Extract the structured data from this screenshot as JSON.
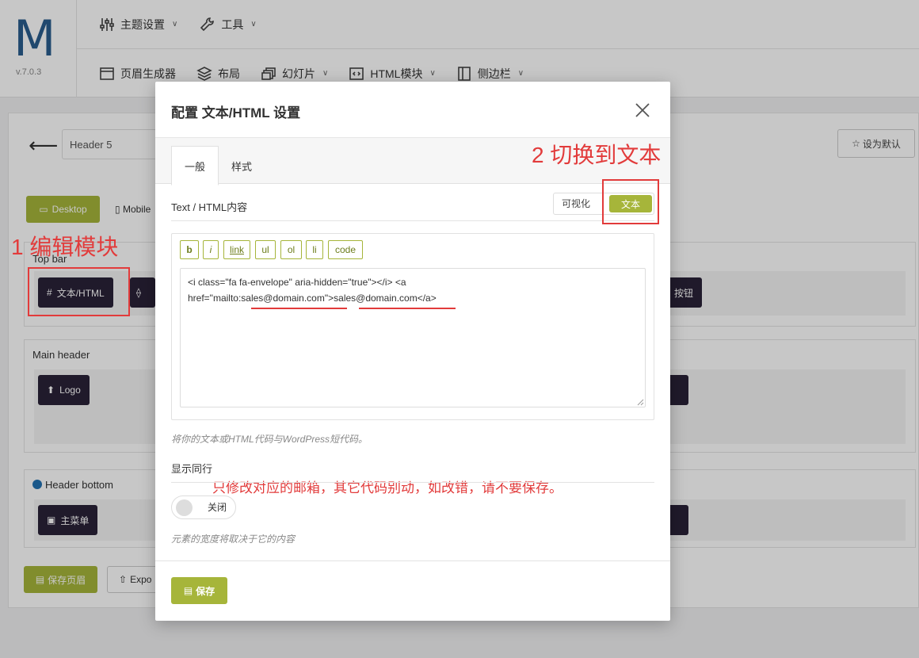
{
  "app": {
    "logo_letter": "M",
    "version": "v.7.0.3",
    "menu_row1": [
      {
        "label": "主题设置",
        "icon": "sliders-icon",
        "dropdown": true
      },
      {
        "label": "工具",
        "icon": "wrench-icon",
        "dropdown": true
      }
    ],
    "menu_row2": [
      {
        "label": "页眉生成器",
        "icon": "window-icon",
        "dropdown": false
      },
      {
        "label": "布局",
        "icon": "layers-icon",
        "dropdown": false
      },
      {
        "label": "幻灯片",
        "icon": "slides-icon",
        "dropdown": true
      },
      {
        "label": "HTML模块",
        "icon": "code-icon",
        "dropdown": true
      },
      {
        "label": "侧边栏",
        "icon": "sidebar-icon",
        "dropdown": true
      }
    ],
    "chevron": "∨"
  },
  "builder": {
    "header_name": "Header 5",
    "set_default": "设为默认",
    "device_desktop": "Desktop",
    "device_mobile": "Mobile",
    "sections": {
      "top_bar": "Top bar",
      "main_header": "Main header",
      "header_bottom": "Header bottom"
    },
    "chips": {
      "text_html": "文本/HTML",
      "button_partial": "按钮",
      "logo": "Logo",
      "main_menu": "主菜单"
    },
    "save_header": "保存页眉",
    "export_partial": "Expo"
  },
  "modal": {
    "title": "配置 文本/HTML 设置",
    "tabs": [
      {
        "label": "一般",
        "active": true
      },
      {
        "label": "样式",
        "active": false
      }
    ],
    "field_label": "Text / HTML内容",
    "mode_visual": "可视化",
    "mode_text": "文本",
    "quicktags": [
      "b",
      "i",
      "link",
      "ul",
      "ol",
      "li",
      "code"
    ],
    "code_line1": "<i class=\"fa fa-envelope\" aria-hidden=\"true\"></i> <a",
    "code_line2_prefix": "href=\"mailto:",
    "code_email": "sales@domain.com",
    "code_line2_mid": "\">",
    "code_line2_suffix": "</a>",
    "help_text": "将你的文本或HTML代码与WordPress短代码。",
    "inline_label": "显示同行",
    "toggle_state": "关闭",
    "toggle_on": false,
    "inline_help": "元素的宽度将取决于它的内容",
    "save": "保存"
  },
  "annotations": {
    "step1": "1 编辑模块",
    "step2": "2 切换到文本",
    "note": "只修改对应的邮箱，其它代码别动，如改错，请不要保存。",
    "color": "#e23b3b"
  },
  "colors": {
    "accent": "#a6b53a",
    "dark_chip": "#2a2238",
    "logo": "#2a5d8e"
  }
}
